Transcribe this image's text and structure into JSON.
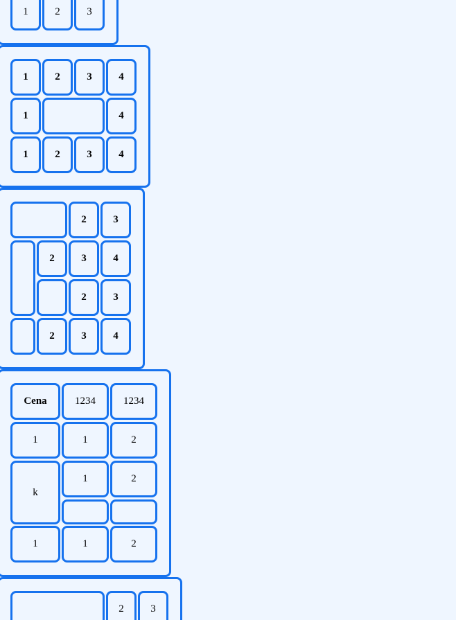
{
  "colors": {
    "border": "#1672ee",
    "background": "#eff6ff"
  },
  "table1": {
    "row1": [
      "1",
      "2",
      "3"
    ]
  },
  "table2": {
    "row1": [
      "1",
      "2",
      "3",
      "4"
    ],
    "row2": [
      "1",
      "",
      "4"
    ],
    "row3": [
      "1",
      "2",
      "3",
      "4"
    ]
  },
  "table3": {
    "row1": [
      "",
      "2",
      "3"
    ],
    "row2": [
      "",
      "2",
      "3",
      "4"
    ],
    "row3": [
      "",
      "2",
      "3"
    ],
    "row4": [
      "",
      "2",
      "3",
      "4"
    ]
  },
  "table4": {
    "header": [
      "Cena",
      "1234",
      "1234"
    ],
    "row1": [
      "1",
      "1",
      "2"
    ],
    "row2": [
      "k",
      "1",
      "2"
    ],
    "row3": [
      "",
      ""
    ],
    "row4": [
      "1",
      "1",
      "2"
    ]
  },
  "table5": {
    "row1": [
      "",
      "2",
      "3"
    ]
  }
}
